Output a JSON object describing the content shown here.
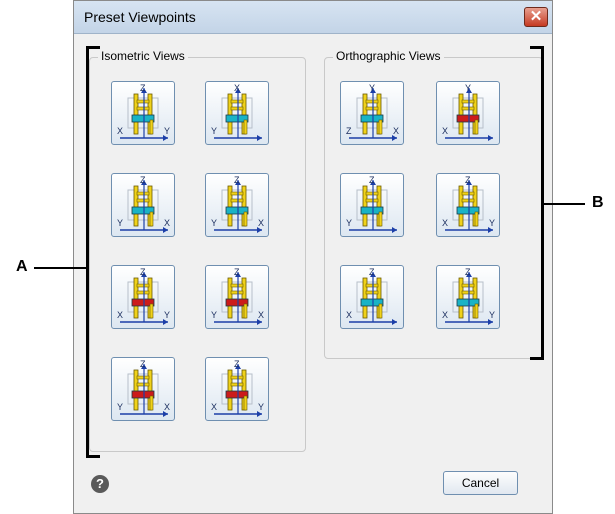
{
  "dialog": {
    "title": "Preset Viewpoints",
    "close_symbol": "✕",
    "cancel_label": "Cancel",
    "help_symbol": "?"
  },
  "isometric": {
    "label": "Isometric Views",
    "buttons": [
      {
        "name": "iso-view-1-button",
        "axes": [
          "Z",
          "X",
          "Y"
        ],
        "seat": "#19b3c6"
      },
      {
        "name": "iso-view-2-button",
        "axes": [
          "X",
          "Y"
        ],
        "seat": "#19b3c6"
      },
      {
        "name": "iso-view-3-button",
        "axes": [
          "Z",
          "Y",
          "X"
        ],
        "seat": "#19b3c6"
      },
      {
        "name": "iso-view-4-button",
        "axes": [
          "Z",
          "Y",
          "X"
        ],
        "seat": "#19b3c6"
      },
      {
        "name": "iso-view-5-button",
        "axes": [
          "Z",
          "X",
          "Y"
        ],
        "seat": "#cc1b1b"
      },
      {
        "name": "iso-view-6-button",
        "axes": [
          "Z",
          "Y",
          "X"
        ],
        "seat": "#cc1b1b"
      },
      {
        "name": "iso-view-7-button",
        "axes": [
          "Z",
          "Y",
          "X"
        ],
        "seat": "#cc1b1b"
      },
      {
        "name": "iso-view-8-button",
        "axes": [
          "Z",
          "X",
          "Y"
        ],
        "seat": "#cc1b1b"
      }
    ]
  },
  "orthographic": {
    "label": "Orthographic Views",
    "buttons": [
      {
        "name": "ortho-top-button",
        "axes": [
          "Y",
          "Z",
          "X"
        ],
        "seat": "#19b3c6"
      },
      {
        "name": "ortho-bottom-button",
        "axes": [
          "Y",
          "X"
        ],
        "seat": "#cc1b1b"
      },
      {
        "name": "ortho-left-button",
        "axes": [
          "Z",
          "Y"
        ],
        "seat": "#19b3c6"
      },
      {
        "name": "ortho-right-button",
        "axes": [
          "Z",
          "X",
          "Y"
        ],
        "seat": "#19b3c6"
      },
      {
        "name": "ortho-front-button",
        "axes": [
          "Z",
          "X"
        ],
        "seat": "#19b3c6"
      },
      {
        "name": "ortho-back-button",
        "axes": [
          "Z",
          "X",
          "Y"
        ],
        "seat": "#19b3c6"
      }
    ]
  },
  "callouts": {
    "a": "A",
    "b": "B"
  },
  "colors": {
    "chair_frame": "#f0d21a",
    "axis": "#1c3fa8"
  }
}
